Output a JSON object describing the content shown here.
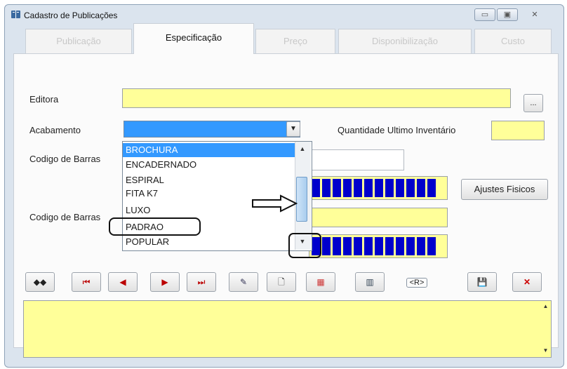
{
  "window": {
    "title": "Cadastro de Publicações"
  },
  "tabs": [
    {
      "label": "Publicação"
    },
    {
      "label": "Especificação"
    },
    {
      "label": "Preço"
    },
    {
      "label": "Disponibilização"
    },
    {
      "label": "Custo"
    }
  ],
  "form": {
    "editora_label": "Editora",
    "editora_button": "...",
    "acabamento_label": "Acabamento",
    "quantidade_label": "Quantidade Ultimo Inventário",
    "codigo_barras_label_1": "Codigo de Barras",
    "codigo_barras_label_2": "Codigo de Barras",
    "ajustes_button": "Ajustes Fisicos"
  },
  "dropdown": {
    "options": [
      "BROCHURA",
      "ENCADERNADO",
      "ESPIRAL",
      "FITA K7",
      "LUXO",
      "PADRAO",
      "POPULAR"
    ],
    "highlighted": "BROCHURA"
  },
  "toolbar": {
    "search_icon": "binoculars-icon",
    "first_icon": "first-record-icon",
    "prev_icon": "previous-icon",
    "next_icon": "next-icon",
    "last_icon": "last-record-icon",
    "edit_icon": "edit-icon",
    "new_icon": "new-document-icon",
    "delete_icon": "delete-record-icon",
    "report_icon": "report-icon",
    "r_label": "<R>",
    "save_icon": "save-icon",
    "cancel_icon": "cancel-icon"
  },
  "colors": {
    "field_yellow": "#ffff99",
    "selection_blue": "#3399ff",
    "barcode_blue": "#0000cc"
  }
}
